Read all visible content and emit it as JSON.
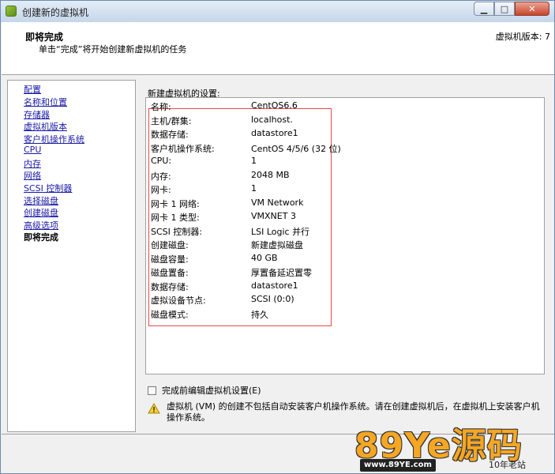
{
  "window": {
    "title": "创建新的虚拟机",
    "min": "▁",
    "max": "□",
    "close": "✕"
  },
  "header": {
    "title": "即将完成",
    "subtitle": "单击“完成”将开始创建新虚拟机的任务",
    "version": "虚拟机版本: 7"
  },
  "nav": {
    "items": [
      "配置",
      "名称和位置",
      "存储器",
      "虚拟机版本",
      "客户机操作系统",
      "CPU",
      "内存",
      "网络",
      "SCSI 控制器",
      "选择磁盘",
      "创建磁盘",
      "高级选项"
    ],
    "current": "即将完成"
  },
  "summary": {
    "label": "新建虚拟机的设置:",
    "rows": [
      {
        "key": "名称:",
        "value": "CentOS6.6"
      },
      {
        "key": "主机/群集:",
        "value": "localhost."
      },
      {
        "key": "数据存储:",
        "value": "datastore1"
      },
      {
        "key": "客户机操作系统:",
        "value": "CentOS 4/5/6 (32 位)"
      },
      {
        "key": "CPU:",
        "value": "1"
      },
      {
        "key": "内存:",
        "value": "2048 MB"
      },
      {
        "key": "网卡:",
        "value": "1"
      },
      {
        "key": "网卡 1 网络:",
        "value": "VM Network"
      },
      {
        "key": "网卡 1 类型:",
        "value": "VMXNET 3"
      },
      {
        "key": "SCSI 控制器:",
        "value": "LSI Logic 并行"
      },
      {
        "key": "创建磁盘:",
        "value": "新建虚拟磁盘"
      },
      {
        "key": "磁盘容量:",
        "value": "40 GB"
      },
      {
        "key": "磁盘置备:",
        "value": "厚置备延迟置零"
      },
      {
        "key": "数据存储:",
        "value": "datastore1"
      },
      {
        "key": "虚拟设备节点:",
        "value": "SCSI (0:0)"
      },
      {
        "key": "磁盘模式:",
        "value": "持久"
      }
    ]
  },
  "options": {
    "edit_before_finish": "完成前编辑虚拟机设置(E)"
  },
  "warning": {
    "icon": "warning-triangle-icon",
    "text": "虚拟机 (VM) 的创建不包括自动安装客户机操作系统。请在创建虚拟机后，在虚拟机上安装客户机操作系统。"
  },
  "watermark": {
    "main": "89Ye源码",
    "url": "www.89YE.com",
    "tag": "10年老站"
  },
  "colors": {
    "link": "#1a1aa6",
    "highlight_border": "#e5484d",
    "logo": "#f5a623"
  }
}
